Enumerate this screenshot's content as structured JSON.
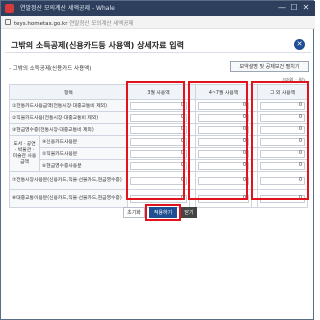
{
  "window": {
    "title": "연말정산 모의계산 세액공제 - Whale",
    "minimize": "—",
    "maximize": "☐",
    "close": "✕"
  },
  "address": {
    "url_host": "teys.hometax.go.kr",
    "url_rest": "연말정산 모의계산 세액공제"
  },
  "dialog": {
    "title": "그밖의 소득공제(신용카드등 사용액) 상세자료 입력",
    "close_glyph": "✕",
    "subtitle": "- 그밖의 소득공제(신용카드 사용액)",
    "guide_button": "보약설명 및 공제보건 펼치기",
    "unit": "(단위 : 원)"
  },
  "table": {
    "headers": {
      "item": "항목",
      "col1": "3월 사용액",
      "col2": "4~7월 사용액",
      "col3": "그 외 사용액"
    },
    "rows": {
      "r1": {
        "label": "①전통카드사용금액(전통시장·대중교통비 제외)",
        "v1": "0",
        "v2": "0",
        "v3": "0"
      },
      "r2": {
        "label": "②직불카드사용(전통시장·대중교통비 제외)",
        "v1": "0",
        "v2": "0",
        "v3": "0"
      },
      "r3": {
        "label": "③현금영수증(전통시장·대중교통비 제외)",
        "v1": "0",
        "v2": "0",
        "v3": "0"
      },
      "group_label": "도서 · 공연 · 박물관 · 미술관 사용금액",
      "r4": {
        "label": "④신용카드사용분",
        "v1": "0",
        "v2": "0",
        "v3": "0"
      },
      "r5": {
        "label": "⑤직불카드사용분",
        "v1": "0",
        "v2": "0",
        "v3": "0"
      },
      "r6": {
        "label": "⑥현금영수증사용분",
        "v1": "0",
        "v2": "0",
        "v3": "0"
      },
      "r7": {
        "label": "⑦전통시장사용분(신용카드,직불·선불카드,현금영수증)",
        "v1": "0",
        "v2": "0",
        "v3": "0"
      },
      "r8": {
        "label": "⑧대중교통이용분(신용카드,직불·선불카드,현금영수증)",
        "v1": "0",
        "v2": "0",
        "v3": "0"
      }
    }
  },
  "buttons": {
    "reset": "초기화",
    "apply": "적용하기",
    "close": "닫기"
  },
  "colors": {
    "highlight": "#e1141e",
    "primary": "#1f4f92",
    "titlebar": "#2d3f5c"
  }
}
